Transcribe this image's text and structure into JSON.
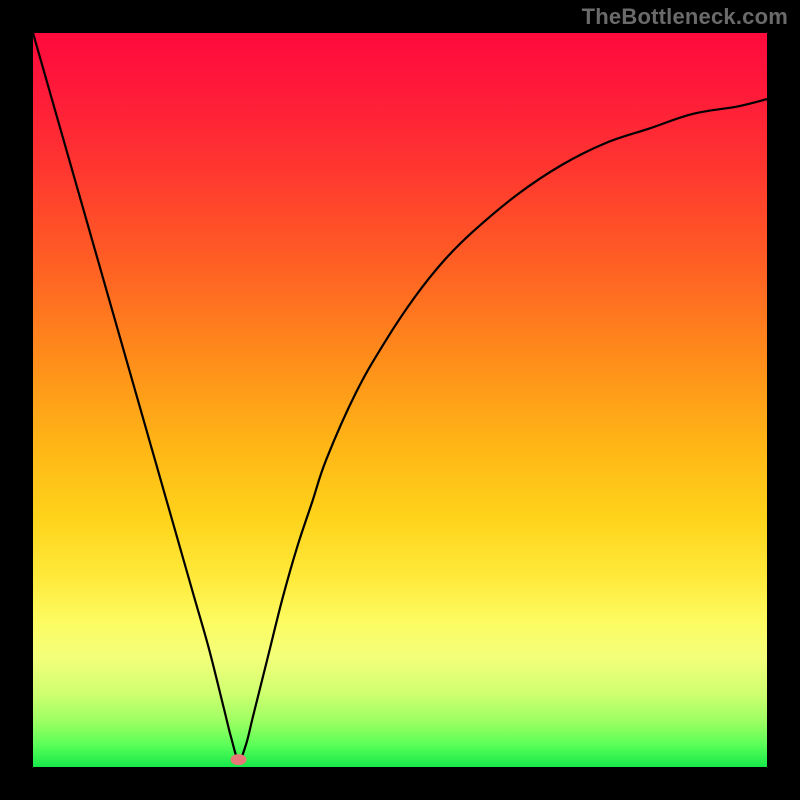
{
  "watermark": "TheBottleneck.com",
  "colors": {
    "frame_bg": "#000000",
    "gradient_top": "#ff0a3c",
    "gradient_bottom": "#16e84a",
    "curve": "#000000",
    "marker_fill": "#e87878",
    "watermark_text": "#6a6a6a"
  },
  "chart_data": {
    "type": "line",
    "title": "",
    "xlabel": "",
    "ylabel": "",
    "xlim": [
      0,
      100
    ],
    "ylim": [
      0,
      100
    ],
    "grid": false,
    "legend": false,
    "series": [
      {
        "name": "bottleneck-curve",
        "comment": "Approximate V-shaped curve: steep descent from top-left to a minimum near x≈28, then concave rise flattening toward top-right. y is percent of plot height from bottom; 100=top, 0=bottom.",
        "x": [
          0,
          2,
          4,
          6,
          8,
          10,
          12,
          14,
          16,
          18,
          20,
          22,
          24,
          26,
          27,
          28,
          29,
          30,
          32,
          34,
          36,
          38,
          40,
          44,
          48,
          52,
          56,
          60,
          66,
          72,
          78,
          84,
          90,
          96,
          100
        ],
        "y": [
          100,
          93,
          86,
          79,
          72,
          65,
          58,
          51,
          44,
          37,
          30,
          23,
          16,
          8,
          4,
          1,
          3,
          7,
          15,
          23,
          30,
          36,
          42,
          51,
          58,
          64,
          69,
          73,
          78,
          82,
          85,
          87,
          89,
          90,
          91
        ]
      }
    ],
    "min_marker": {
      "x": 28,
      "y": 1
    }
  }
}
